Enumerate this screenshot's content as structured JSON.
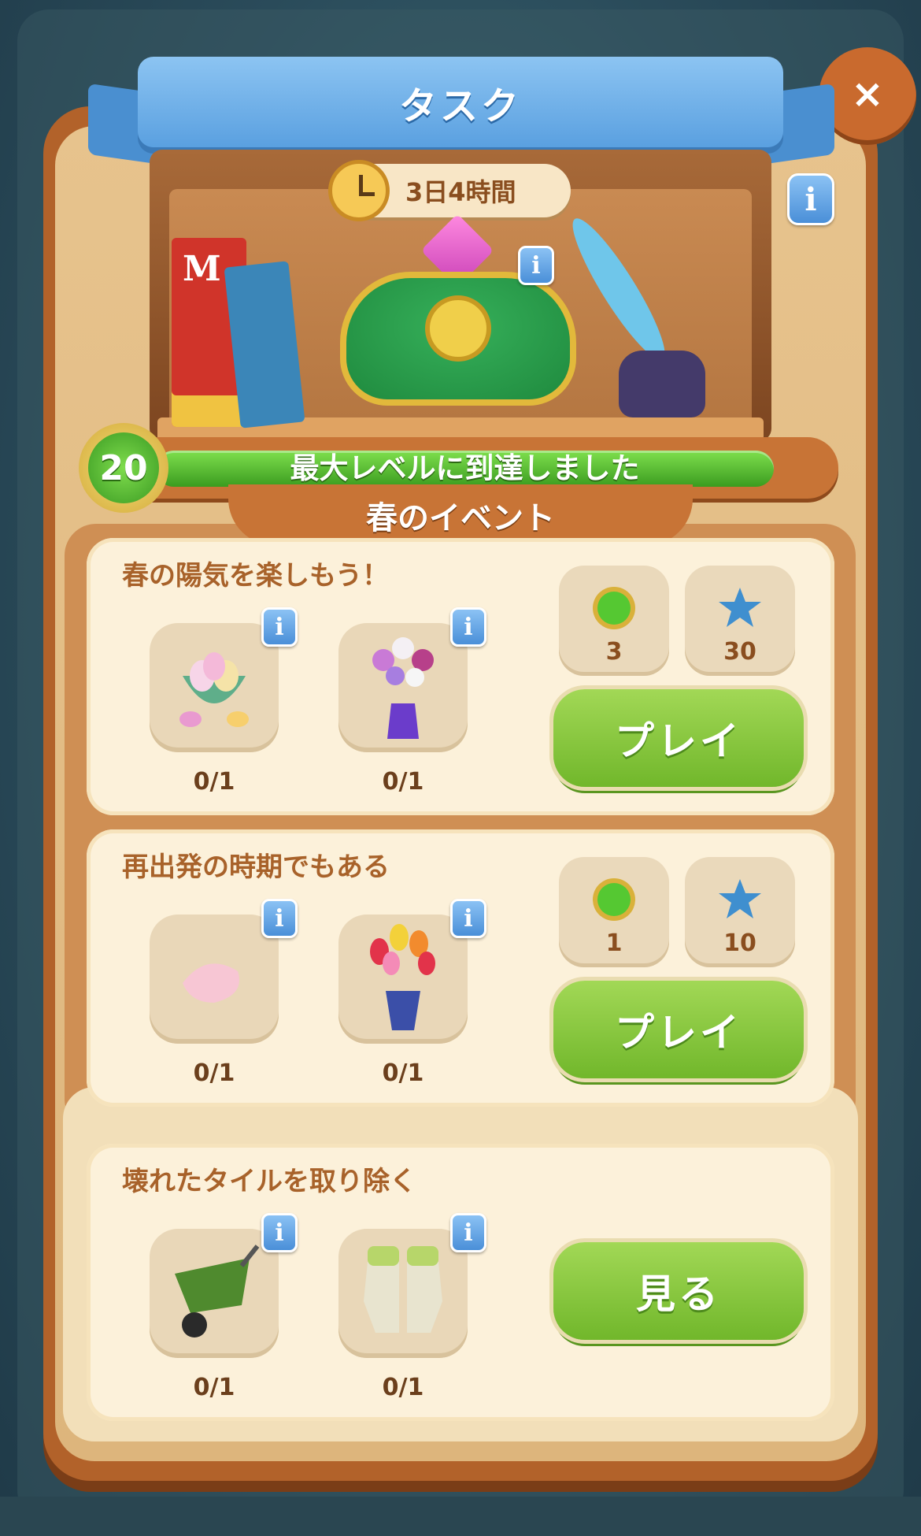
{
  "header": {
    "title": "タスク",
    "close_symbol": "×"
  },
  "timer": {
    "text": "3日4時間"
  },
  "level": {
    "number": "20",
    "status": "最大レベルに到達しました"
  },
  "event": {
    "title": "春のイベント"
  },
  "tasks": [
    {
      "title": "春の陽気を楽しもう！",
      "items": [
        {
          "icon": "egg-basket-icon",
          "progress": "0/1"
        },
        {
          "icon": "flower-vase-icon",
          "progress": "0/1"
        }
      ],
      "rewards": [
        {
          "icon": "green-gem-icon",
          "value": "3"
        },
        {
          "icon": "blue-star-icon",
          "value": "30"
        }
      ],
      "button": "プレイ"
    },
    {
      "title": "再出発の時期でもある",
      "items": [
        {
          "icon": "petal-icon",
          "progress": "0/1"
        },
        {
          "icon": "tulip-pot-icon",
          "progress": "0/1"
        }
      ],
      "rewards": [
        {
          "icon": "green-gem-icon",
          "value": "1"
        },
        {
          "icon": "blue-star-icon",
          "value": "10"
        }
      ],
      "button": "プレイ"
    },
    {
      "title": "壊れたタイルを取り除く",
      "items": [
        {
          "icon": "wheelbarrow-icon",
          "progress": "0/1"
        },
        {
          "icon": "garden-gloves-icon",
          "progress": "0/1"
        }
      ],
      "button": "見る"
    }
  ],
  "decor": {
    "book_letter": "M",
    "info_glyph": "i"
  },
  "colors": {
    "ribbon": "#5aa0e0",
    "button_green": "#71b72b",
    "panel_brown": "#b2622a"
  }
}
